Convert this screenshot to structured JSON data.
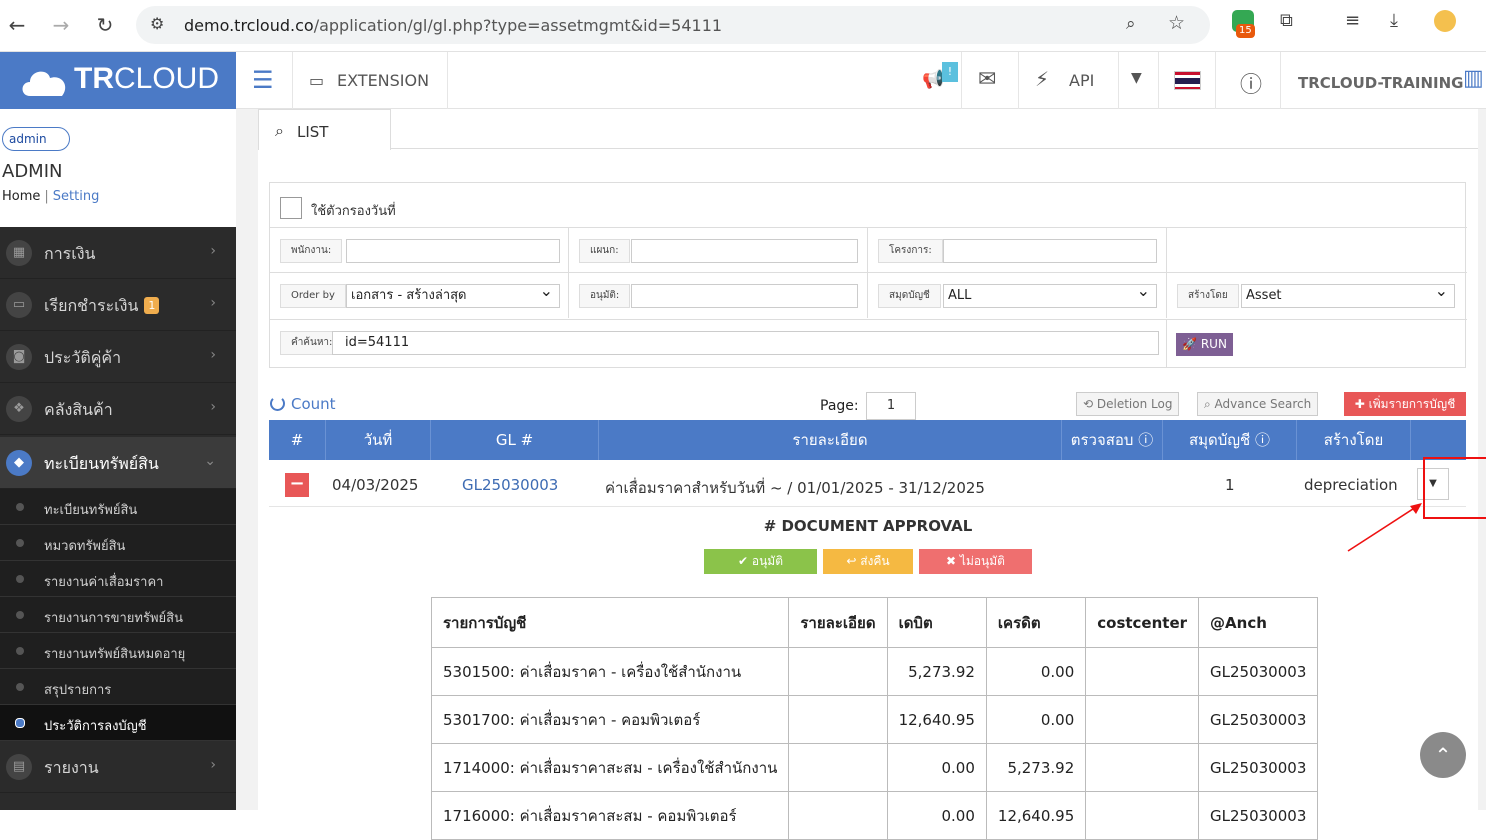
{
  "browser": {
    "url_host": "demo.trcloud.co",
    "url_path": "/application/gl/gl.php?type=assetmgmt&id=54111",
    "ext_badge": "15"
  },
  "logo": {
    "bold": "TR",
    "light": "CLOUD"
  },
  "user": {
    "avatar_alt": "admin",
    "name": "ADMIN",
    "home": "Home",
    "sep": "|",
    "setting": "Setting"
  },
  "menu": [
    {
      "label": "การเงิน",
      "icon": "calendar-icon"
    },
    {
      "label": "เรียกชำระเงิน",
      "icon": "card-icon",
      "badge": "1"
    },
    {
      "label": "ประวัติคู่ค้า",
      "icon": "contact-icon"
    },
    {
      "label": "คลังสินค้า",
      "icon": "boxes-icon"
    },
    {
      "label": "ทะเบียนทรัพย์สิน",
      "icon": "diamond-icon"
    },
    {
      "label": "รายงาน",
      "icon": "report-icon"
    }
  ],
  "submenu": [
    "ทะเบียนทรัพย์สิน",
    "หมวดทรัพย์สิน",
    "รายงานค่าเสื่อมราคา",
    "รายงานการขายทรัพย์สิน",
    "รายงานทรัพย์สินหมดอายุ",
    "สรุปรายการ",
    "ประวัติการลงบัญชี"
  ],
  "topbar": {
    "extension": "EXTENSION",
    "notif_badge": "!",
    "api": "API",
    "company": "TRCLOUD-TRAINING"
  },
  "tab": {
    "list": "LIST"
  },
  "filter": {
    "date_filter_label": "ใช้ตัวกรองวันที่",
    "employee_label": "พนักงาน:",
    "employee_value": "",
    "department_label": "แผนก:",
    "department_value": "",
    "project_label": "โครงการ:",
    "project_value": "",
    "orderby_label": "Order by",
    "orderby_value": "เอกสาร - สร้างล่าสุด",
    "approve_label": "อนุมัติ:",
    "approve_value": "",
    "journal_label": "สมุดบัญชี",
    "journal_value": "ALL",
    "createdby_label": "สร้างโดย",
    "createdby_value": "Asset",
    "search_label": "คำค้นหา:",
    "search_value": "id=54111",
    "run": "RUN"
  },
  "toolbar": {
    "count": "Count",
    "page_label": "Page:",
    "page_value": "1",
    "deletion_log": "Deletion Log",
    "advance_search": "Advance Search",
    "add": "เพิ่มรายการบัญชี"
  },
  "table": {
    "headers": [
      "#",
      "วันที่",
      "GL #",
      "รายละเอียด",
      "ตรวจสอบ",
      "สมุดบัญชี",
      "สร้างโดย"
    ],
    "row": {
      "date": "04/03/2025",
      "gl": "GL25030003",
      "detail": "ค่าเสื่อมราคาสำหรับวันที่ ~ / 01/01/2025 - 31/12/2025",
      "journal": "1",
      "created_by": "depreciation"
    }
  },
  "approval": {
    "title": "# DOCUMENT APPROVAL",
    "approve": "อนุมัติ",
    "return": "ส่งคืน",
    "reject": "ไม่อนุมัติ"
  },
  "entries": {
    "headers": [
      "รายการบัญชี",
      "รายละเอียด",
      "เดบิต",
      "เครดิต",
      "costcenter",
      "@Anch"
    ],
    "rows": [
      [
        "5301500: ค่าเสื่อมราคา - เครื่องใช้สำนักงาน",
        "",
        "5,273.92",
        "0.00",
        "",
        "GL25030003"
      ],
      [
        "5301700: ค่าเสื่อมราคา - คอมพิวเตอร์",
        "",
        "12,640.95",
        "0.00",
        "",
        "GL25030003"
      ],
      [
        "1714000: ค่าเสื่อมราคาสะสม - เครื่องใช้สำนักงาน",
        "",
        "0.00",
        "5,273.92",
        "",
        "GL25030003"
      ],
      [
        "1716000: ค่าเสื่อมราคาสะสม - คอมพิวเตอร์",
        "",
        "0.00",
        "12,640.95",
        "",
        "GL25030003"
      ]
    ]
  },
  "colors": {
    "brand": "#4b7ac6",
    "danger": "#e85757",
    "success": "#8bc34a",
    "warning": "#f5b942"
  }
}
